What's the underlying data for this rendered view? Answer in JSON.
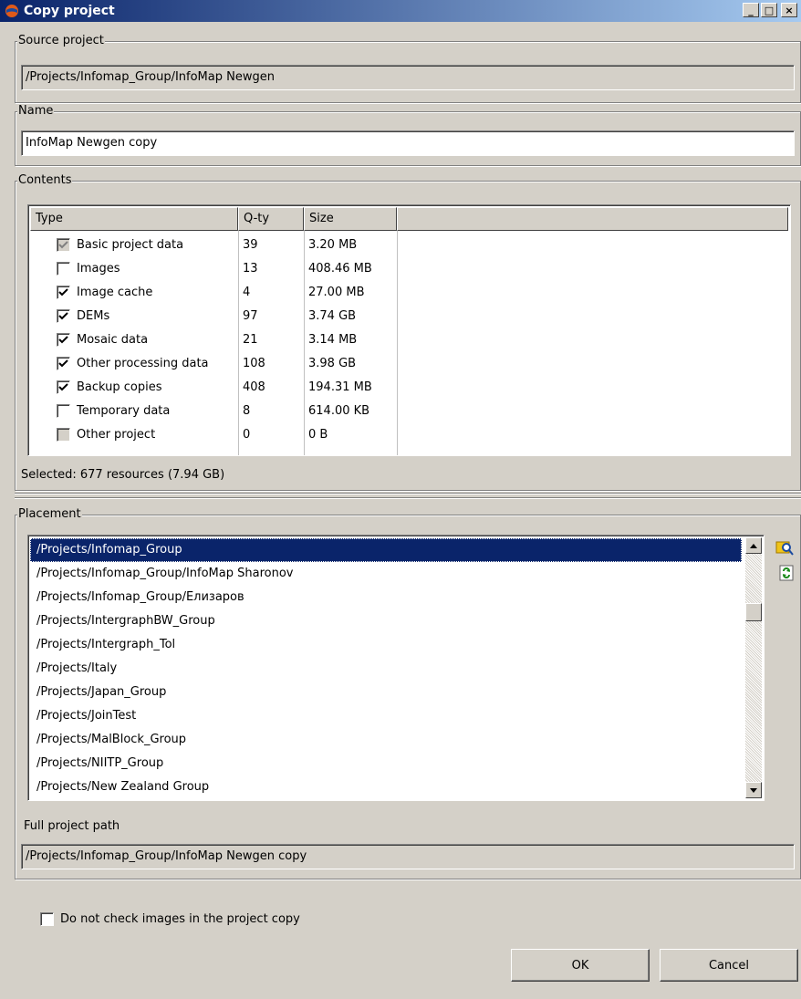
{
  "window": {
    "title": "Copy project",
    "minimize_label": "_",
    "maximize_label": "□",
    "close_label": "×"
  },
  "source": {
    "legend": "Source project",
    "value": "/Projects/Infomap_Group/InfoMap Newgen"
  },
  "name": {
    "legend": "Name",
    "value": "InfoMap Newgen copy"
  },
  "contents": {
    "legend": "Contents",
    "columns": [
      "Type",
      "Q-ty",
      "Size"
    ],
    "rows": [
      {
        "type": "Basic project data",
        "qty": "39",
        "size": "3.20 MB",
        "checked": true,
        "disabled": true
      },
      {
        "type": "Images",
        "qty": "13",
        "size": "408.46 MB",
        "checked": false,
        "disabled": false
      },
      {
        "type": "Image cache",
        "qty": "4",
        "size": "27.00 MB",
        "checked": true,
        "disabled": false
      },
      {
        "type": "DEMs",
        "qty": "97",
        "size": "3.74 GB",
        "checked": true,
        "disabled": false
      },
      {
        "type": "Mosaic data",
        "qty": "21",
        "size": "3.14 MB",
        "checked": true,
        "disabled": false
      },
      {
        "type": "Other processing data",
        "qty": "108",
        "size": "3.98 GB",
        "checked": true,
        "disabled": false
      },
      {
        "type": "Backup copies",
        "qty": "408",
        "size": "194.31 MB",
        "checked": true,
        "disabled": false
      },
      {
        "type": "Temporary data",
        "qty": "8",
        "size": "614.00 KB",
        "checked": false,
        "disabled": false
      },
      {
        "type": "Other project",
        "qty": "0",
        "size": "0 B",
        "checked": false,
        "disabled": true
      }
    ],
    "selected_text": "Selected: 677 resources (7.94 GB)"
  },
  "placement": {
    "legend": "Placement",
    "items": [
      "/Projects/Infomap_Group",
      "/Projects/Infomap_Group/InfoMap Sharonov",
      "/Projects/Infomap_Group/Елизаров",
      "/Projects/IntergraphBW_Group",
      "/Projects/Intergraph_Tol",
      "/Projects/Italy",
      "/Projects/Japan_Group",
      "/Projects/JoinTest",
      "/Projects/MalBlock_Group",
      "/Projects/NIITP_Group",
      "/Projects/New Zealand Group"
    ],
    "selected_index": 0,
    "side_icons": [
      "search-folder-icon",
      "refresh-icon"
    ],
    "full_path_label": "Full project path",
    "full_path_value": "/Projects/Infomap_Group/InfoMap Newgen copy"
  },
  "options": {
    "no_check_images_label": "Do not check images in the project copy",
    "no_check_images_checked": false
  },
  "buttons": {
    "ok": "OK",
    "cancel": "Cancel"
  },
  "colors": {
    "title_bar": "#0a246a",
    "dialog_bg": "#d4d0c8",
    "selection": "#0a246a"
  }
}
